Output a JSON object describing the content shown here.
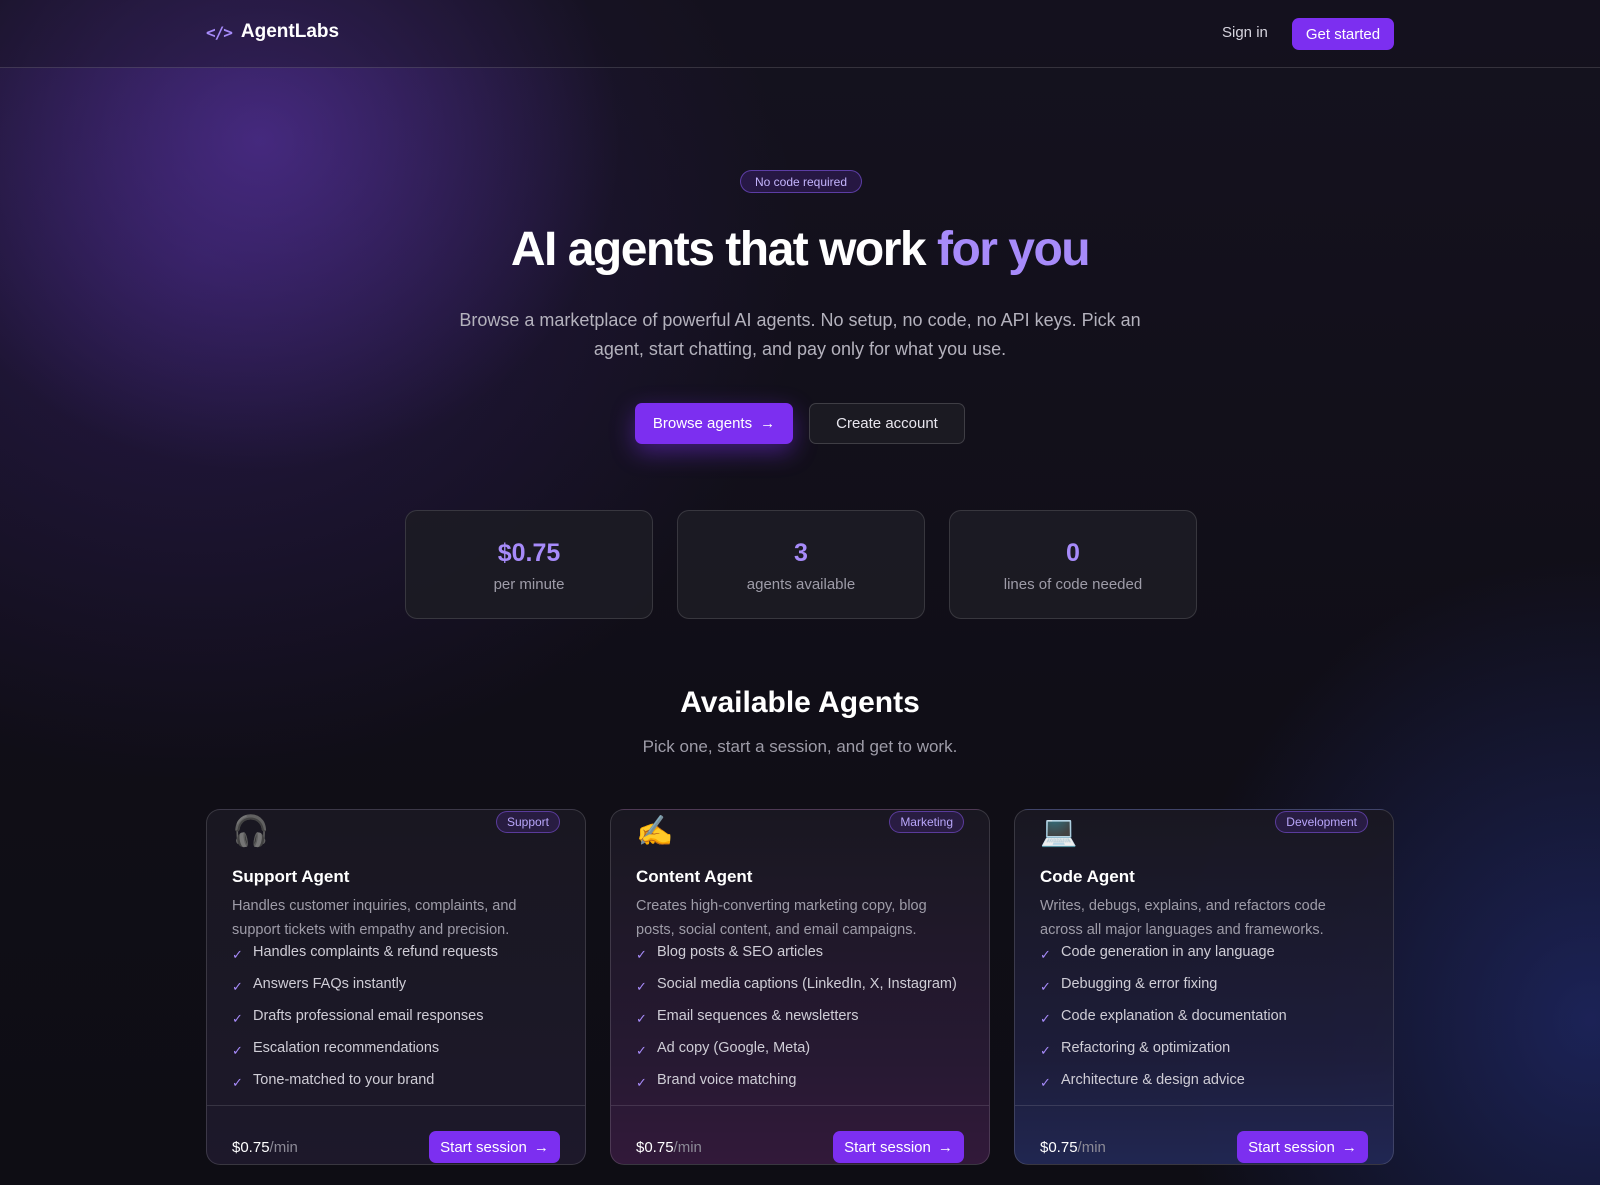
{
  "nav": {
    "brand_icon": "</>",
    "brand_name": "AgentLabs",
    "signin_label": "Sign in",
    "get_started_label": "Get started"
  },
  "hero": {
    "pill": "No code required",
    "title_main": "AI agents that work ",
    "title_accent": "for you",
    "subtitle": "Browse a marketplace of powerful AI agents. No setup, no code, no API keys. Pick an agent, start chatting, and pay only for what you use.",
    "browse_label": "Browse agents",
    "create_label": "Create account",
    "arrow_icon": "arrow-right-icon"
  },
  "stats": [
    {
      "value": "$0.75",
      "label": "per minute"
    },
    {
      "value": "3",
      "label": "agents available"
    },
    {
      "value": "0",
      "label": "lines of code needed"
    }
  ],
  "section": {
    "title": "Available Agents",
    "subtitle": "Pick one, start a session, and get to work."
  },
  "colors": {
    "accent": "#7c2ff0",
    "accent_text": "#a78bfa",
    "background": "#0f0e15"
  },
  "agents": [
    {
      "icon": "🎧",
      "icon_name": "headphones-icon",
      "badge": "Support",
      "title": "Support Agent",
      "description": "Handles customer inquiries, complaints, and support tickets with empathy and precision.",
      "features": [
        "Handles complaints & refund requests",
        "Answers FAQs instantly",
        "Drafts professional email responses",
        "Escalation recommendations",
        "Tone-matched to your brand"
      ],
      "price": "$0.75",
      "unit": "/min",
      "cta": "Start session"
    },
    {
      "icon": "✍️",
      "icon_name": "writing-hand-icon",
      "badge": "Marketing",
      "title": "Content Agent",
      "description": "Creates high-converting marketing copy, blog posts, social content, and email campaigns.",
      "features": [
        "Blog posts & SEO articles",
        "Social media captions (LinkedIn, X, Instagram)",
        "Email sequences & newsletters",
        "Ad copy (Google, Meta)",
        "Brand voice matching"
      ],
      "price": "$0.75",
      "unit": "/min",
      "cta": "Start session"
    },
    {
      "icon": "💻",
      "icon_name": "laptop-icon",
      "badge": "Development",
      "title": "Code Agent",
      "description": "Writes, debugs, explains, and refactors code across all major languages and frameworks.",
      "features": [
        "Code generation in any language",
        "Debugging & error fixing",
        "Code explanation & documentation",
        "Refactoring & optimization",
        "Architecture & design advice"
      ],
      "price": "$0.75",
      "unit": "/min",
      "cta": "Start session"
    }
  ]
}
